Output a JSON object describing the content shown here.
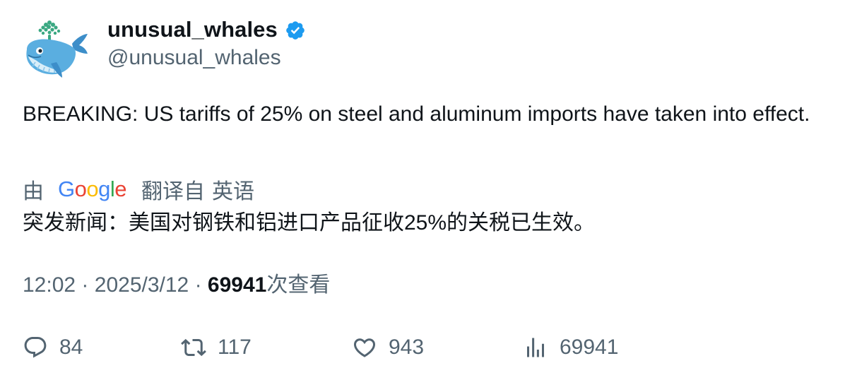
{
  "author": {
    "display_name": "unusual_whales",
    "handle": "@unusual_whales",
    "verified": true
  },
  "tweet": {
    "text": "BREAKING: US tariffs of 25% on steel and aluminum imports have taken into effect.",
    "translation": {
      "prefix": "由",
      "provider": "Google",
      "suffix_part1": "翻译自",
      "suffix_part2": "英语",
      "text": "突发新闻：美国对钢铁和铝进口产品征收25%的关税已生效。"
    },
    "meta": {
      "time": "12:02",
      "separator": "·",
      "date": "2025/3/12",
      "views": "69941",
      "views_label": "次查看"
    }
  },
  "actions": {
    "replies": "84",
    "retweets": "117",
    "likes": "943",
    "views": "69941"
  },
  "colors": {
    "text_primary": "#0f1419",
    "text_secondary": "#536471",
    "verified_blue": "#1d9bf0"
  }
}
